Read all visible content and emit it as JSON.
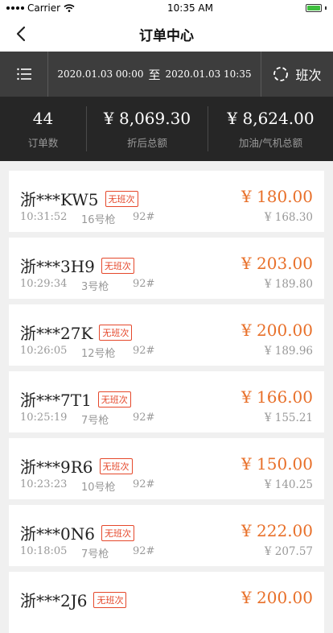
{
  "status_bar": {
    "carrier": "Carrier",
    "time": "10:35 AM"
  },
  "nav": {
    "title": "订单中心"
  },
  "filter": {
    "start": "2020.01.03 00:00",
    "to_label": "至",
    "end": "2020.01.03 10:35",
    "shift_label": "班次"
  },
  "summary": {
    "count_value": "44",
    "count_label": "订单数",
    "discount_value": "¥ 8,069.30",
    "discount_label": "折后总额",
    "total_value": "¥ 8,624.00",
    "total_label": "加油/气机总额"
  },
  "orders": [
    {
      "plate": "浙***KW5",
      "badge": "无班次",
      "time": "10:31:52",
      "gun": "16号枪",
      "fuel": "92#",
      "amount": "¥ 180.00",
      "paid": "¥ 168.30"
    },
    {
      "plate": "浙***3H9",
      "badge": "无班次",
      "time": "10:29:34",
      "gun": "3号枪",
      "fuel": "92#",
      "amount": "¥ 203.00",
      "paid": "¥ 189.80"
    },
    {
      "plate": "浙***27K",
      "badge": "无班次",
      "time": "10:26:05",
      "gun": "12号枪",
      "fuel": "92#",
      "amount": "¥ 200.00",
      "paid": "¥ 189.96"
    },
    {
      "plate": "浙***7T1",
      "badge": "无班次",
      "time": "10:25:19",
      "gun": "7号枪",
      "fuel": "92#",
      "amount": "¥ 166.00",
      "paid": "¥ 155.21"
    },
    {
      "plate": "浙***9R6",
      "badge": "无班次",
      "time": "10:23:23",
      "gun": "10号枪",
      "fuel": "92#",
      "amount": "¥ 150.00",
      "paid": "¥ 140.25"
    },
    {
      "plate": "浙***0N6",
      "badge": "无班次",
      "time": "10:18:05",
      "gun": "7号枪",
      "fuel": "92#",
      "amount": "¥ 222.00",
      "paid": "¥ 207.57"
    },
    {
      "plate": "浙***2J6",
      "badge": "无班次",
      "time": "",
      "gun": "",
      "fuel": "",
      "amount": "¥ 200.00",
      "paid": ""
    }
  ],
  "icons": {
    "back": "chevron-left-icon",
    "menu": "list-icon",
    "shift": "circle-dashed-icon",
    "wifi": "wifi-icon",
    "battery": "battery-icon"
  },
  "colors": {
    "price": "#e8702a",
    "badge": "#e5482b",
    "filter_bg": "#3d3d3d",
    "summary_bg": "#262626"
  }
}
